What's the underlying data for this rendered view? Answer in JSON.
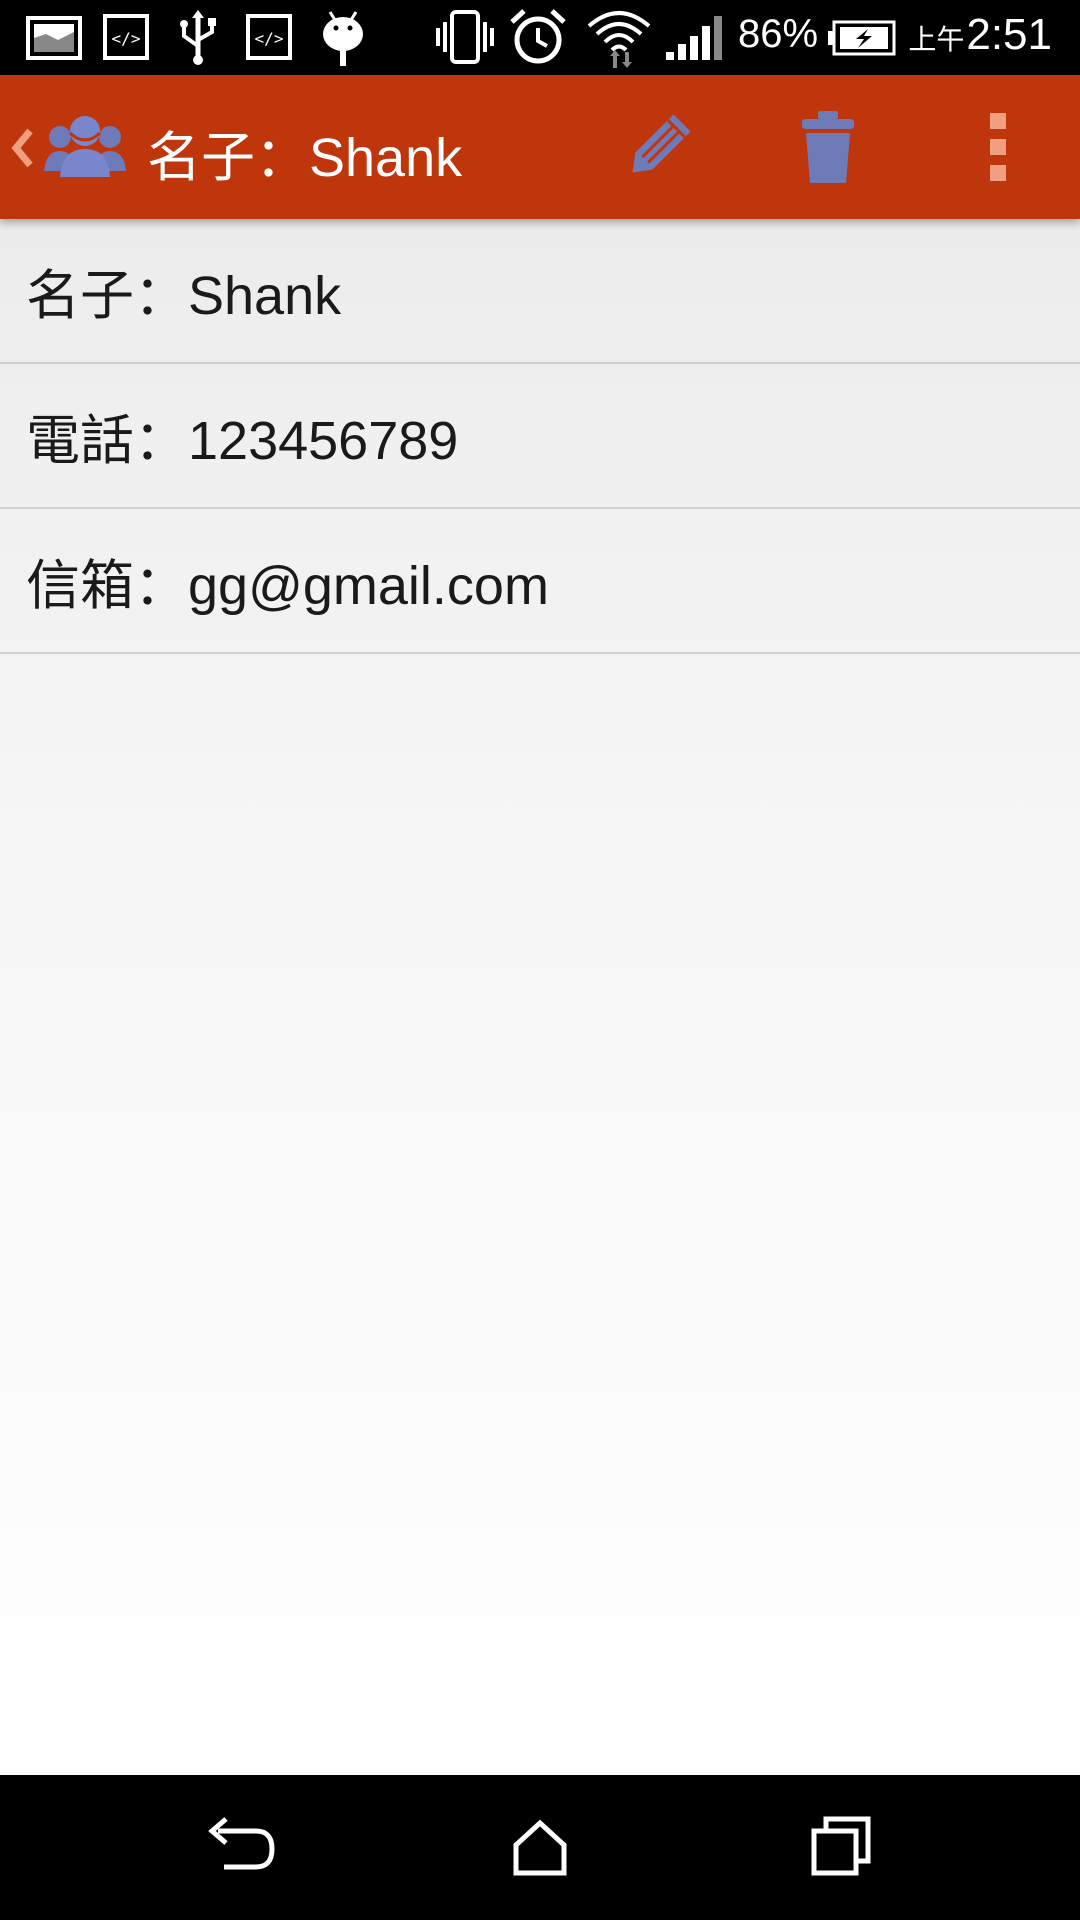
{
  "status_bar": {
    "battery_percent": "86%",
    "clock_ampm": "上午",
    "clock_time": "2:51",
    "icons": [
      "image-icon",
      "code-icon",
      "usb-icon",
      "code-icon",
      "android-icon",
      "vibrate-icon",
      "alarm-icon",
      "wifi-icon",
      "signal-icon",
      "battery-charging-icon"
    ]
  },
  "app_bar": {
    "title": "名子：Shank",
    "background_color": "#bf360c",
    "actions": [
      "edit-icon",
      "delete-icon",
      "overflow-menu-icon"
    ]
  },
  "contact": {
    "rows": [
      {
        "text": "名子：Shank"
      },
      {
        "text": "電話：123456789"
      },
      {
        "text": "信箱：gg@gmail.com"
      }
    ]
  },
  "nav_bar": {
    "buttons": [
      "back-icon",
      "home-icon",
      "recents-icon"
    ]
  }
}
